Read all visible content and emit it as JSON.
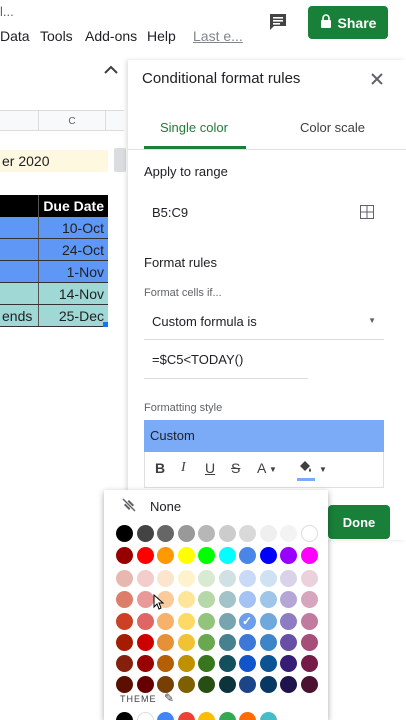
{
  "topbar": {
    "title_fragment": "l...",
    "menus": [
      "Data",
      "Tools",
      "Add-ons",
      "Help"
    ],
    "last_edit": "Last e...",
    "share_label": "Share"
  },
  "sheet": {
    "column_header": "C",
    "title_cell": "er 2020",
    "header": {
      "a": "",
      "b": "Due Date"
    },
    "rows": [
      {
        "a": "",
        "b": "10-Oct",
        "style": "blue"
      },
      {
        "a": "",
        "b": "24-Oct",
        "style": "blue"
      },
      {
        "a": "",
        "b": "1-Nov",
        "style": "blue"
      },
      {
        "a": "",
        "b": "14-Nov",
        "style": "teal"
      },
      {
        "a": "ends",
        "b": "25-Dec",
        "style": "teal"
      }
    ]
  },
  "panel": {
    "title": "Conditional format rules",
    "tab_single": "Single color",
    "tab_scale": "Color scale",
    "apply_to_range_label": "Apply to range",
    "range": "B5:C9",
    "format_rules_label": "Format rules",
    "format_cells_if": "Format cells if...",
    "condition": "Custom formula is",
    "formula": "=$C5<TODAY()",
    "formatting_style_label": "Formatting style",
    "style_name": "Custom",
    "toolbar": {
      "bold": "B",
      "italic": "I",
      "underline": "U",
      "strike": "S",
      "text_color": "A"
    },
    "done_label": "Done"
  },
  "picker": {
    "none_label": "None",
    "theme_label": "THEME",
    "grays": [
      "#000000",
      "#434343",
      "#666666",
      "#999999",
      "#b7b7b7",
      "#cccccc",
      "#d9d9d9",
      "#efefef",
      "#f3f3f3",
      "#ffffff"
    ],
    "brights": [
      "#980000",
      "#ff0000",
      "#ff9900",
      "#ffff00",
      "#00ff00",
      "#00ffff",
      "#4a86e8",
      "#0000ff",
      "#9900ff",
      "#ff00ff"
    ],
    "shades": [
      [
        "#e6b8af",
        "#f4cccc",
        "#fce5cd",
        "#fff2cc",
        "#d9ead3",
        "#d0e0e3",
        "#c9daf8",
        "#cfe2f3",
        "#d9d2e9",
        "#ead1dc"
      ],
      [
        "#dd7e6b",
        "#ea9999",
        "#f9cb9c",
        "#ffe599",
        "#b6d7a8",
        "#a2c4c9",
        "#a4c2f4",
        "#9fc5e8",
        "#b4a7d6",
        "#d5a6bd"
      ],
      [
        "#cc4125",
        "#e06666",
        "#f6b26b",
        "#ffd966",
        "#93c47d",
        "#76a5af",
        "#6d9eeb",
        "#6fa8dc",
        "#8e7cc3",
        "#c27ba0"
      ],
      [
        "#a61c00",
        "#cc0000",
        "#e69138",
        "#f1c232",
        "#6aa84f",
        "#45818e",
        "#3c78d8",
        "#3d85c6",
        "#674ea7",
        "#a64d79"
      ],
      [
        "#85200c",
        "#990000",
        "#b45f06",
        "#bf9000",
        "#38761d",
        "#134f5c",
        "#1155cc",
        "#0b5394",
        "#351c75",
        "#741b47"
      ],
      [
        "#5b0f00",
        "#660000",
        "#783f04",
        "#7f6000",
        "#274e13",
        "#0c343d",
        "#1c4587",
        "#073763",
        "#20124d",
        "#4c1130"
      ]
    ],
    "theme_colors": [
      "#000000",
      "#ffffff",
      "#4285f4",
      "#ea4335",
      "#fbbc04",
      "#34a853",
      "#ff6d01",
      "#46bdc6"
    ],
    "selected": {
      "row": 2,
      "col": 6
    }
  }
}
